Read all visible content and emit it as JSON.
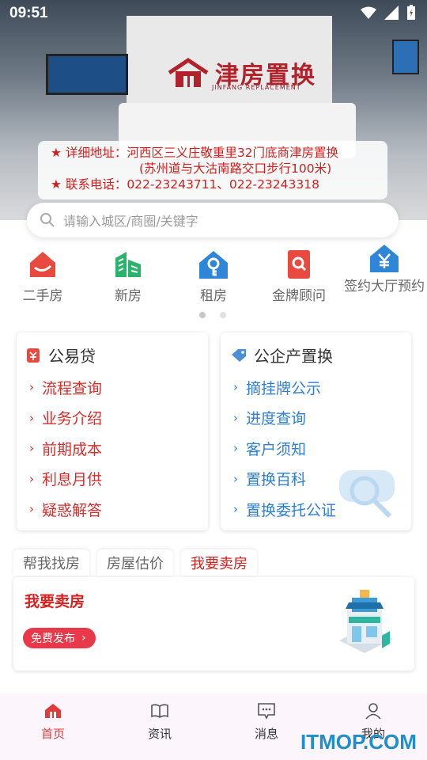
{
  "status_bar": {
    "time": "09:51"
  },
  "hero": {
    "logo_name": "津房置换",
    "logo_sub": "JINFANG REPLACEMENT",
    "address_line1": "★ 详细地址：河西区三义庄敬重里32门底商津房置换",
    "address_line2": "(苏州道与大沽南路交口步行100米)",
    "phone_line": "★ 联系电话：022-23243711、022-23243318"
  },
  "search": {
    "placeholder": "请输入城区/商圈/关键字"
  },
  "categories": [
    {
      "label": "二手房",
      "icon": "house-hand-icon",
      "color": "#e84a3f"
    },
    {
      "label": "新房",
      "icon": "building-icon",
      "color": "#29b36b"
    },
    {
      "label": "租房",
      "icon": "key-house-icon",
      "color": "#2f86d8"
    },
    {
      "label": "金牌顾问",
      "icon": "search-book-icon",
      "color": "#e84a3f"
    },
    {
      "label": "签约大厅预约",
      "icon": "yuan-house-icon",
      "color": "#2f86d8"
    }
  ],
  "loan_card": {
    "title": "公易贷",
    "items": [
      "流程查询",
      "业务介绍",
      "前期成本",
      "利息月供",
      "疑惑解答"
    ]
  },
  "replace_card": {
    "title": "公企产置换",
    "items": [
      "摘挂牌公示",
      "进度查询",
      "客户须知",
      "置换百科",
      "置换委托公证"
    ]
  },
  "tabs": [
    "帮我找房",
    "房屋估价",
    "我要卖房"
  ],
  "sell_panel": {
    "title": "我要卖房",
    "button": "免费发布"
  },
  "bottom_nav": [
    {
      "label": "首页",
      "icon": "home-icon"
    },
    {
      "label": "资讯",
      "icon": "book-icon"
    },
    {
      "label": "消息",
      "icon": "message-icon"
    },
    {
      "label": "我的",
      "icon": "user-icon"
    }
  ],
  "watermark": "ITMOP.COM",
  "colors": {
    "accent_red": "#d62121",
    "link_blue": "#2f7fd3"
  }
}
